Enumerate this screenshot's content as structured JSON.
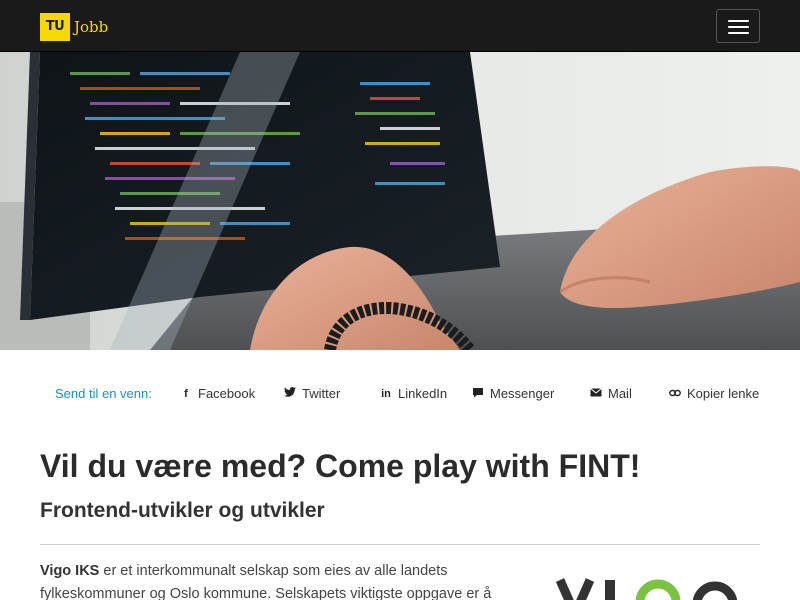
{
  "header": {
    "logo_mark": "TU",
    "logo_text": "Jobb"
  },
  "share": {
    "label": "Send til en venn:",
    "items": [
      {
        "label": "Facebook",
        "icon": "facebook-icon"
      },
      {
        "label": "Twitter",
        "icon": "twitter-icon"
      },
      {
        "label": "LinkedIn",
        "icon": "linkedin-icon"
      },
      {
        "label": "Messenger",
        "icon": "messenger-icon"
      },
      {
        "label": "Mail",
        "icon": "mail-icon"
      },
      {
        "label": "Kopier lenke",
        "icon": "link-icon"
      }
    ]
  },
  "article": {
    "title": "Vil du være med? Come play with FINT!",
    "subtitle": "Frontend-utvikler og utvikler",
    "intro_bold": "Vigo IKS",
    "intro_rest": " er et interkommunalt selskap som eies av alle landets fylkeskommuner og Oslo kommune. Selskapets viktigste oppgave er å"
  },
  "colors": {
    "header_bg": "#1a1a1a",
    "brand_yellow": "#f5d800",
    "link_blue": "#1b8fc9",
    "vigo_green": "#7cc242"
  }
}
